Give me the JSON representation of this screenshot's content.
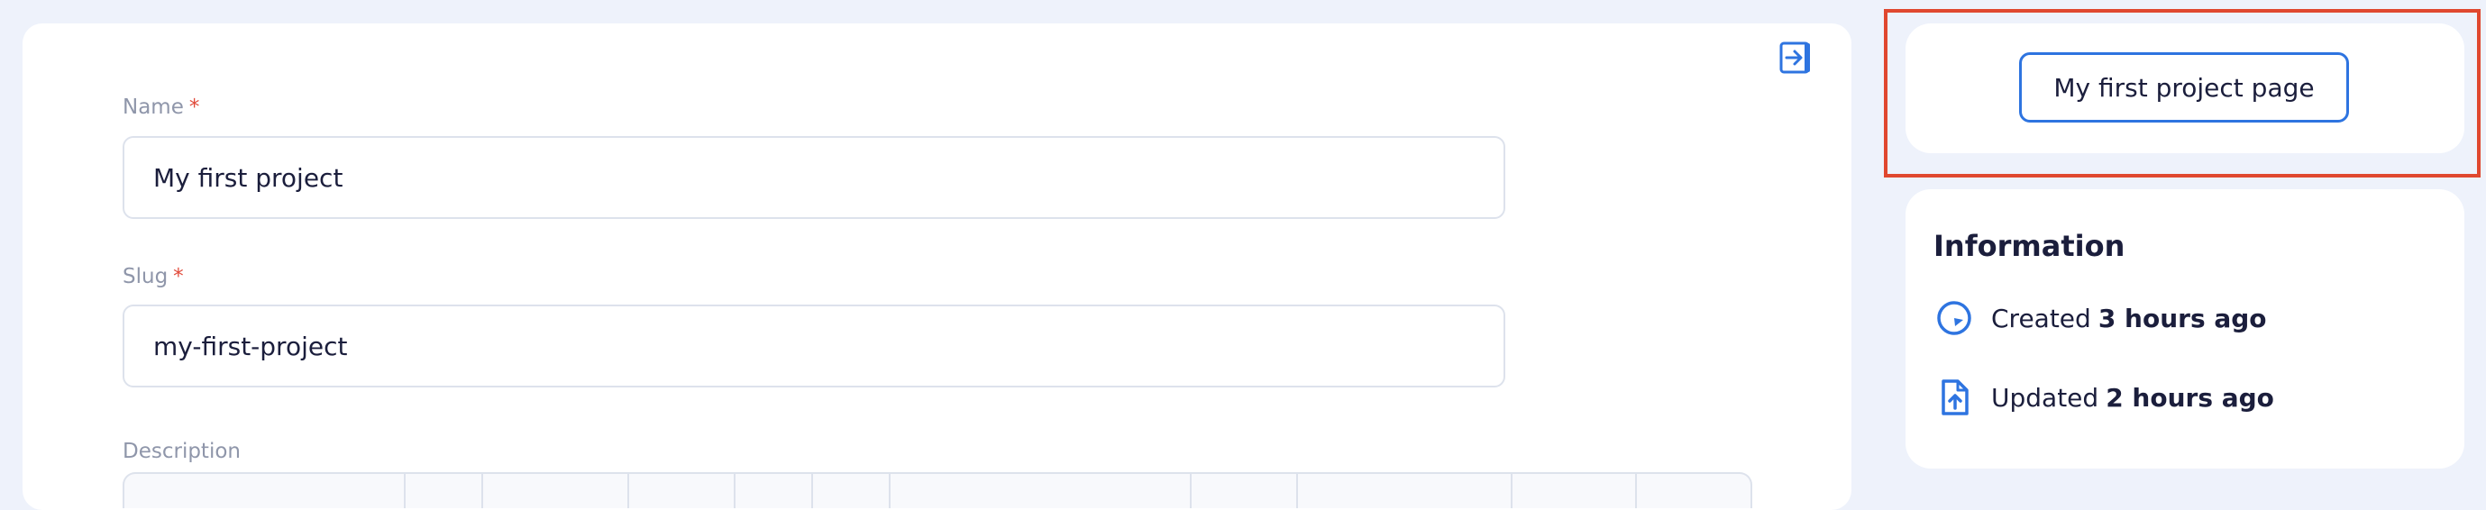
{
  "form": {
    "name_label": "Name",
    "name_required": "*",
    "name_value": "My first project",
    "slug_label": "Slug",
    "slug_required": "*",
    "slug_value": "my-first-project",
    "description_label": "Description"
  },
  "icons": {
    "exit": "arrow-right-to-bracket-icon",
    "created": "clock-icon",
    "updated": "file-upload-icon"
  },
  "sidebar": {
    "page_button_label": "My first project page",
    "info_title": "Information",
    "created_prefix": "Created",
    "created_value": "3 hours ago",
    "updated_prefix": "Updated",
    "updated_value": "2 hours ago"
  },
  "colors": {
    "accent": "#2e74e0",
    "required": "#e14b3b",
    "highlight": "#e0482f"
  }
}
